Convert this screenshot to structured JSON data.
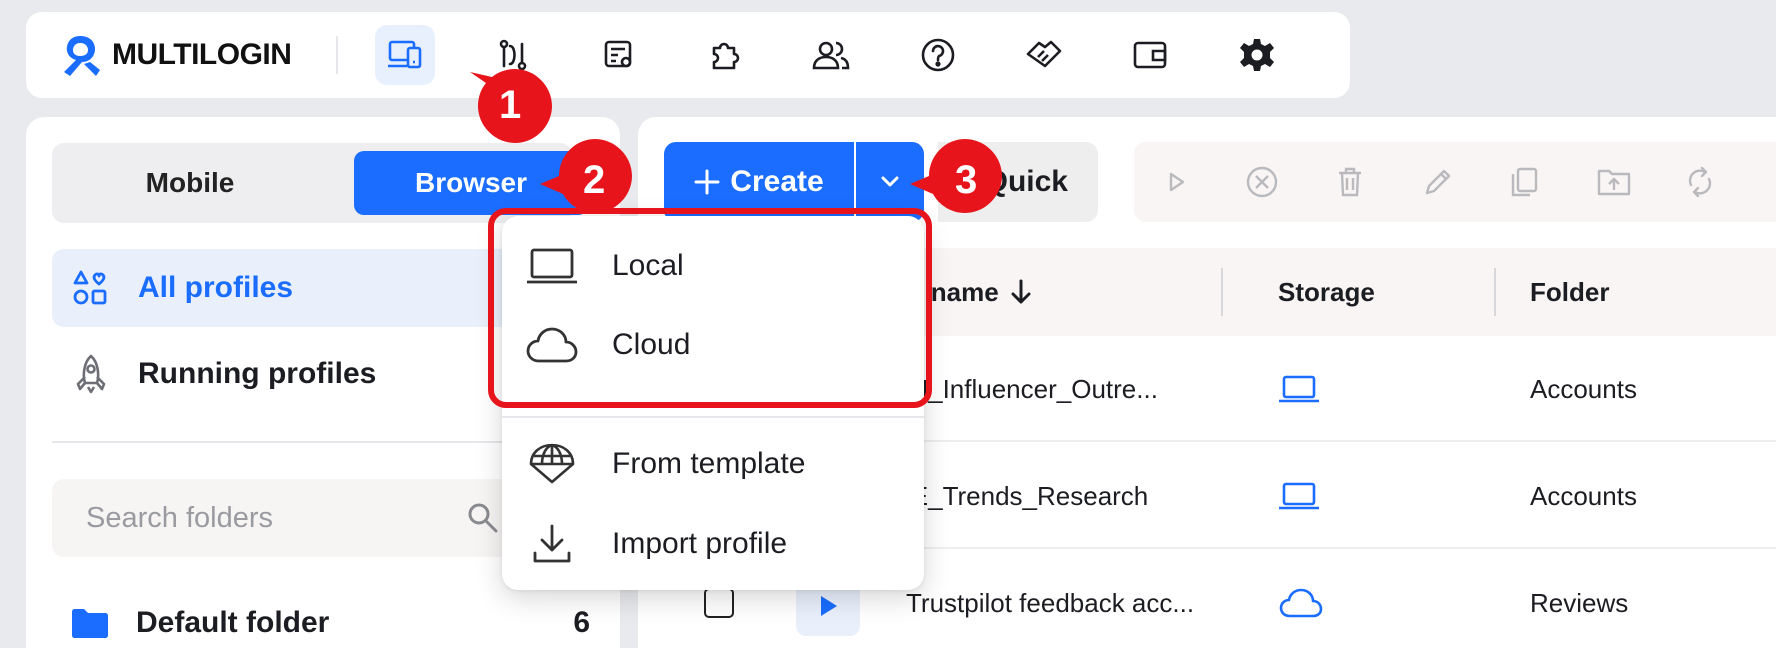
{
  "brand": {
    "name": "MULTILOGIN",
    "accent": "#1a6dff",
    "highlight": "#e8141b"
  },
  "topnav": {
    "icons": [
      "profiles-devices-icon",
      "automation-icon",
      "templates-icon",
      "extensions-icon",
      "team-icon",
      "help-icon",
      "affiliate-icon",
      "wallet-icon",
      "settings-icon"
    ]
  },
  "sidebar": {
    "tabs": {
      "mobile": "Mobile",
      "browser": "Browser"
    },
    "all_profiles": "All profiles",
    "running_profiles": "Running profiles",
    "search_placeholder": "Search folders",
    "folders": [
      {
        "name": "Default folder",
        "count": "6"
      }
    ]
  },
  "toolbar": {
    "create_label": "Create",
    "quick_label": "Quick"
  },
  "create_menu": {
    "items": [
      "Local",
      "Cloud",
      "From template",
      "Import profile"
    ]
  },
  "table": {
    "columns": {
      "name": "file name",
      "storage": "Storage",
      "folder": "Folder"
    },
    "rows": [
      {
        "name": "EU_Influencer_Outre...",
        "storage": "local",
        "folder": "Accounts"
      },
      {
        "name": "DE_Trends_Research",
        "storage": "local",
        "folder": "Accounts"
      },
      {
        "name": "Trustpilot feedback acc...",
        "storage": "cloud",
        "folder": "Reviews"
      }
    ]
  },
  "callouts": [
    "1",
    "2",
    "3"
  ]
}
